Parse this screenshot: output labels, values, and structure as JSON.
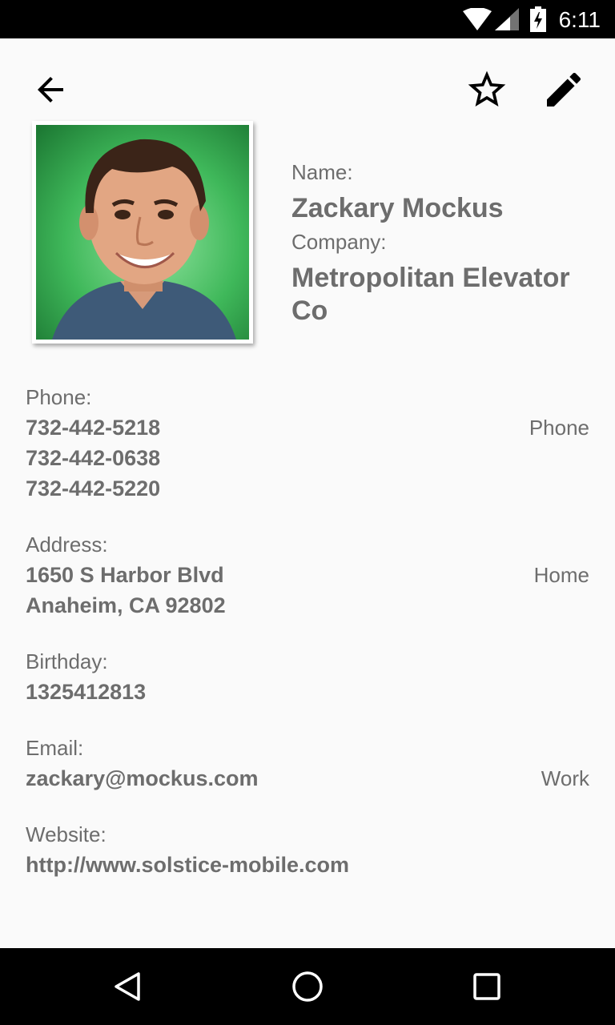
{
  "status_bar": {
    "time": "6:11",
    "icons": [
      "wifi-icon",
      "cell-signal-icon",
      "battery-charging-icon"
    ]
  },
  "toolbar": {
    "back_icon": "arrow-back-icon",
    "favorite_icon": "star-outline-icon",
    "edit_icon": "pencil-icon"
  },
  "contact": {
    "name_label": "Name:",
    "name": "Zackary Mockus",
    "company_label": "Company:",
    "company": "Metropolitan Elevator Co"
  },
  "phone": {
    "label": "Phone:",
    "numbers": [
      "732-442-5218",
      "732-442-0638",
      "732-442-5220"
    ],
    "type": "Phone"
  },
  "address": {
    "label": "Address:",
    "lines": [
      "1650 S Harbor Blvd",
      "Anaheim, CA 92802"
    ],
    "type": "Home"
  },
  "birthday": {
    "label": "Birthday:",
    "value": "1325412813"
  },
  "email": {
    "label": "Email:",
    "value": "zackary@mockus.com",
    "type": "Work"
  },
  "website": {
    "label": "Website:",
    "value": "http://www.solstice-mobile.com"
  },
  "nav_bar": {
    "icons": [
      "nav-back-icon",
      "nav-home-icon",
      "nav-recents-icon"
    ]
  },
  "colors": {
    "status_bar_bg": "#000000",
    "screen_bg": "#fafafa",
    "text": "#6d6d6d",
    "icon": "#000000",
    "photo_bg": "#2f9a4a"
  }
}
